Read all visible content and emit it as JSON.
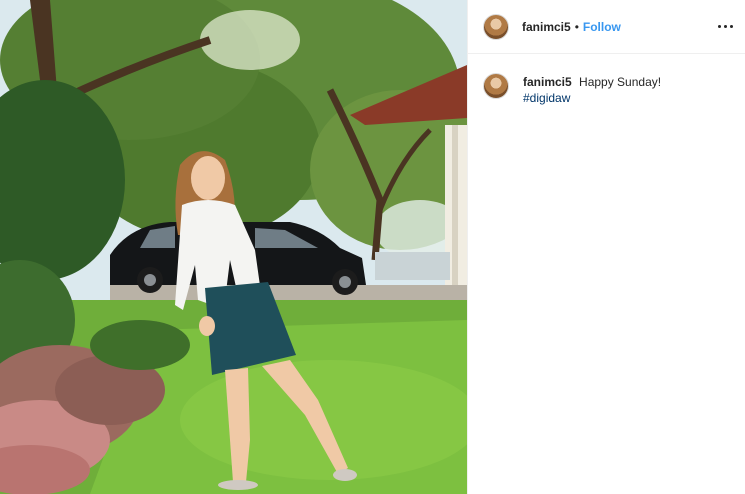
{
  "post": {
    "username": "fanimci5",
    "separator": "•",
    "follow_label": "Follow"
  },
  "comment": {
    "username": "fanimci5",
    "text": "Happy Sunday!",
    "hashtag": "#digidaw"
  },
  "icons": {
    "more": "more-options-icon"
  }
}
